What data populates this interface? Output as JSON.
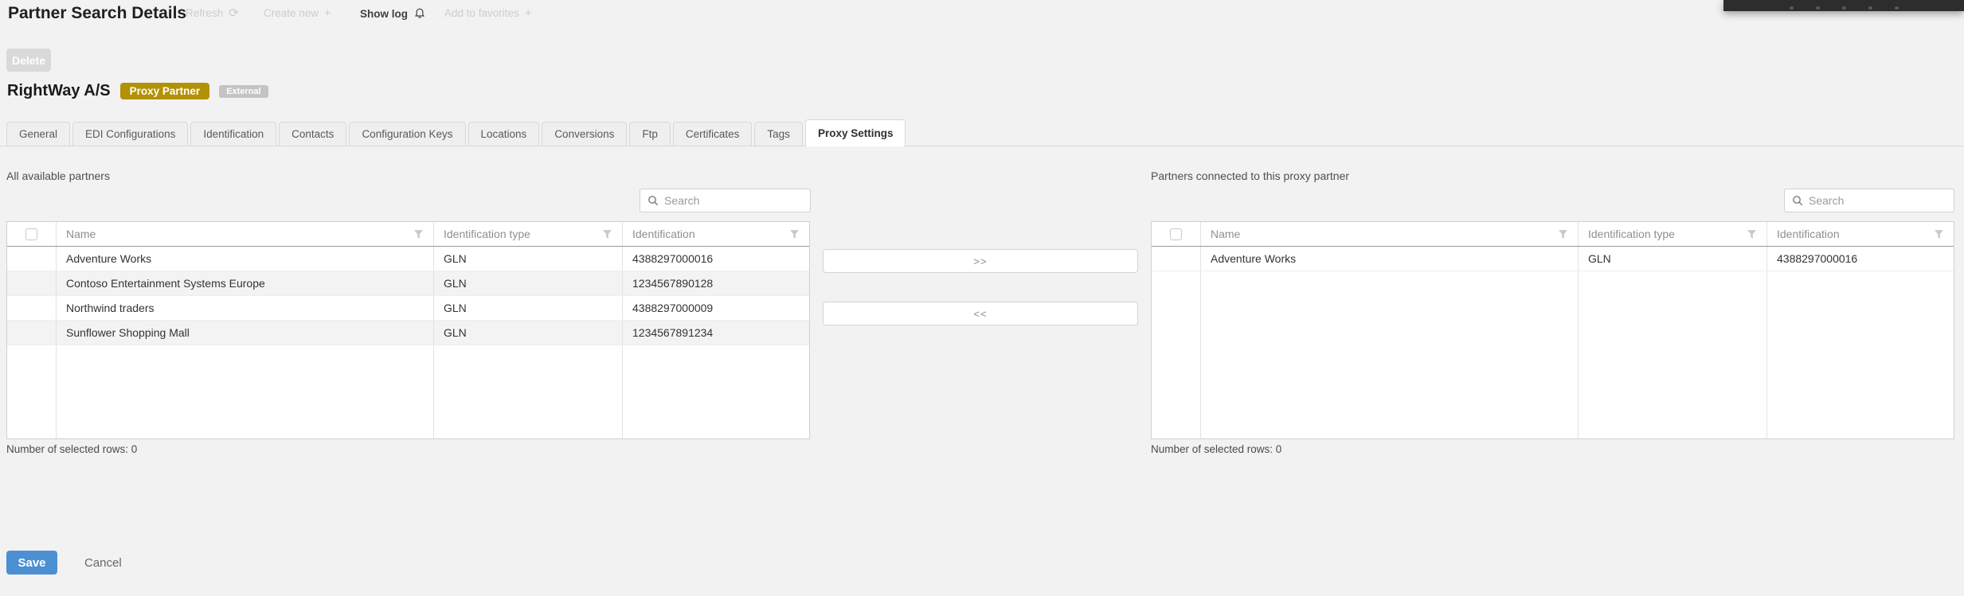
{
  "colors": {
    "accent_blue": "#4a90d2",
    "badge_gold": "#b29104",
    "badge_gray": "#c4c4c4"
  },
  "header": {
    "title": "Partner Search Details",
    "actions": {
      "refresh": "Refresh",
      "create_new": "Create new",
      "show_log": "Show log",
      "add_to_favorites": "Add to favorites"
    },
    "delete_button": "Delete"
  },
  "partner": {
    "name": "RightWay A/S",
    "type_badge": "Proxy Partner",
    "external_badge": "External"
  },
  "tabs": {
    "items": [
      "General",
      "EDI Configurations",
      "Identification",
      "Contacts",
      "Configuration Keys",
      "Locations",
      "Conversions",
      "Ftp",
      "Certificates",
      "Tags",
      "Proxy Settings"
    ],
    "active": "Proxy Settings"
  },
  "left_panel": {
    "title": "All available partners",
    "search_placeholder": "Search",
    "columns": [
      "Name",
      "Identification type",
      "Identification"
    ],
    "rows": [
      {
        "name": "Adventure Works",
        "id_type": "GLN",
        "identification": "4388297000016"
      },
      {
        "name": "Contoso Entertainment Systems Europe",
        "id_type": "GLN",
        "identification": "1234567890128"
      },
      {
        "name": "Northwind traders",
        "id_type": "GLN",
        "identification": "4388297000009"
      },
      {
        "name": "Sunflower Shopping Mall",
        "id_type": "GLN",
        "identification": "1234567891234"
      }
    ],
    "footer": "Number of selected rows: 0"
  },
  "transfer": {
    "move_right_label": ">>",
    "move_left_label": "<<"
  },
  "right_panel": {
    "title": "Partners connected to this proxy partner",
    "search_placeholder": "Search",
    "columns": [
      "Name",
      "Identification type",
      "Identification"
    ],
    "rows": [
      {
        "name": "Adventure Works",
        "id_type": "GLN",
        "identification": "4388297000016"
      }
    ],
    "footer": "Number of selected rows: 0"
  },
  "footer_actions": {
    "save_label": "Save",
    "cancel_label": "Cancel"
  }
}
